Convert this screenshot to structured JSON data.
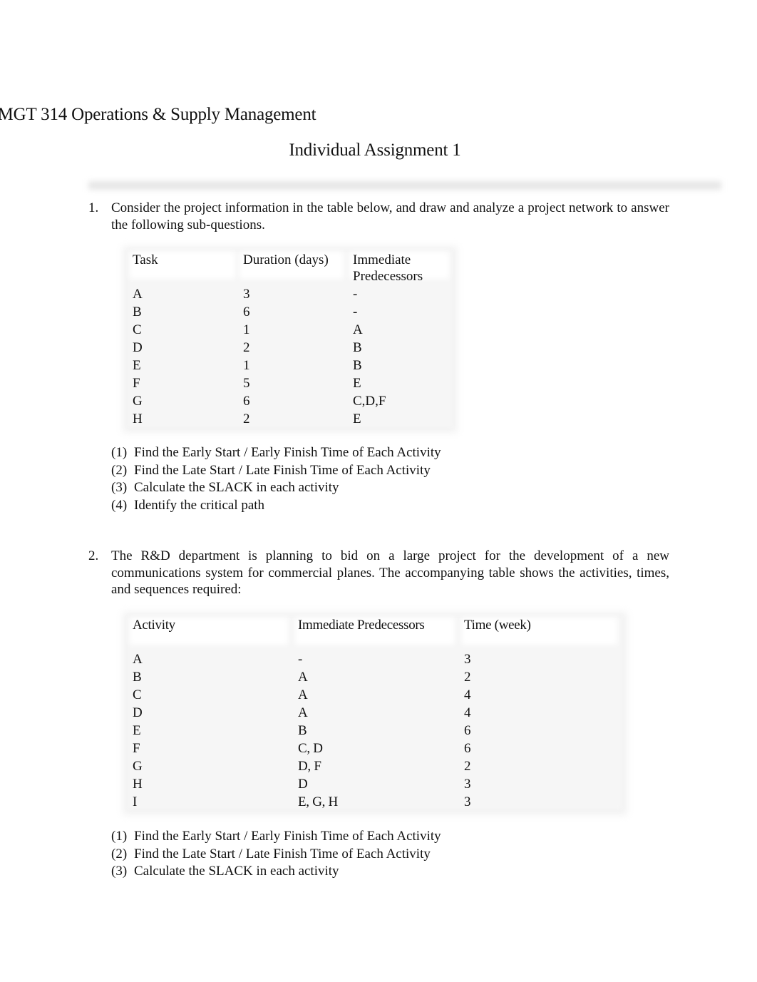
{
  "document": {
    "title": "MGT 314 Operations & Supply Management",
    "subtitle": "Individual Assignment 1"
  },
  "question1": {
    "number": "1.",
    "text": "Consider the project information in the table below, and draw and analyze a project network to answer the following sub-questions.",
    "table": {
      "headers": [
        "Task",
        "Duration (days)",
        "Immediate",
        "Predecessors"
      ],
      "rows": [
        {
          "task": "A",
          "duration": "3",
          "predecessors": "-"
        },
        {
          "task": "B",
          "duration": "6",
          "predecessors": "-"
        },
        {
          "task": "C",
          "duration": "1",
          "predecessors": "A"
        },
        {
          "task": "D",
          "duration": "2",
          "predecessors": "B"
        },
        {
          "task": "E",
          "duration": "1",
          "predecessors": "B"
        },
        {
          "task": "F",
          "duration": "5",
          "predecessors": "E"
        },
        {
          "task": "G",
          "duration": "6",
          "predecessors": "C,D,F"
        },
        {
          "task": "H",
          "duration": "2",
          "predecessors": "E"
        }
      ]
    },
    "subquestions": [
      {
        "num": "(1)",
        "text": "Find the Early Start / Early Finish Time of Each Activity"
      },
      {
        "num": "(2)",
        "text": "Find the Late Start / Late Finish Time of Each Activity"
      },
      {
        "num": "(3)",
        "text": "Calculate the SLACK in each activity"
      },
      {
        "num": "(4)",
        "text": "Identify the critical path"
      }
    ]
  },
  "question2": {
    "number": "2.",
    "text": "The R&D department is planning to bid on a large project for the development of a new communications system for commercial planes. The accompanying table shows the activities, times, and sequences required:",
    "table": {
      "headers": [
        "Activity",
        "Immediate Predecessors",
        "Time (week)"
      ],
      "rows": [
        {
          "activity": "A",
          "predecessors": "-",
          "time": "3"
        },
        {
          "activity": "B",
          "predecessors": "A",
          "time": "2"
        },
        {
          "activity": "C",
          "predecessors": "A",
          "time": "4"
        },
        {
          "activity": "D",
          "predecessors": "A",
          "time": "4"
        },
        {
          "activity": "E",
          "predecessors": "B",
          "time": "6"
        },
        {
          "activity": "F",
          "predecessors": "C, D",
          "time": "6"
        },
        {
          "activity": "G",
          "predecessors": "D, F",
          "time": "2"
        },
        {
          "activity": "H",
          "predecessors": "D",
          "time": "3"
        },
        {
          "activity": "I",
          "predecessors": "E, G, H",
          "time": "3"
        }
      ]
    },
    "subquestions": [
      {
        "num": "(1)",
        "text": "Find the Early Start / Early Finish Time of Each Activity"
      },
      {
        "num": "(2)",
        "text": "Find the Late Start / Late Finish Time of Each Activity"
      },
      {
        "num": "(3)",
        "text": "Calculate the SLACK in each activity"
      }
    ]
  }
}
